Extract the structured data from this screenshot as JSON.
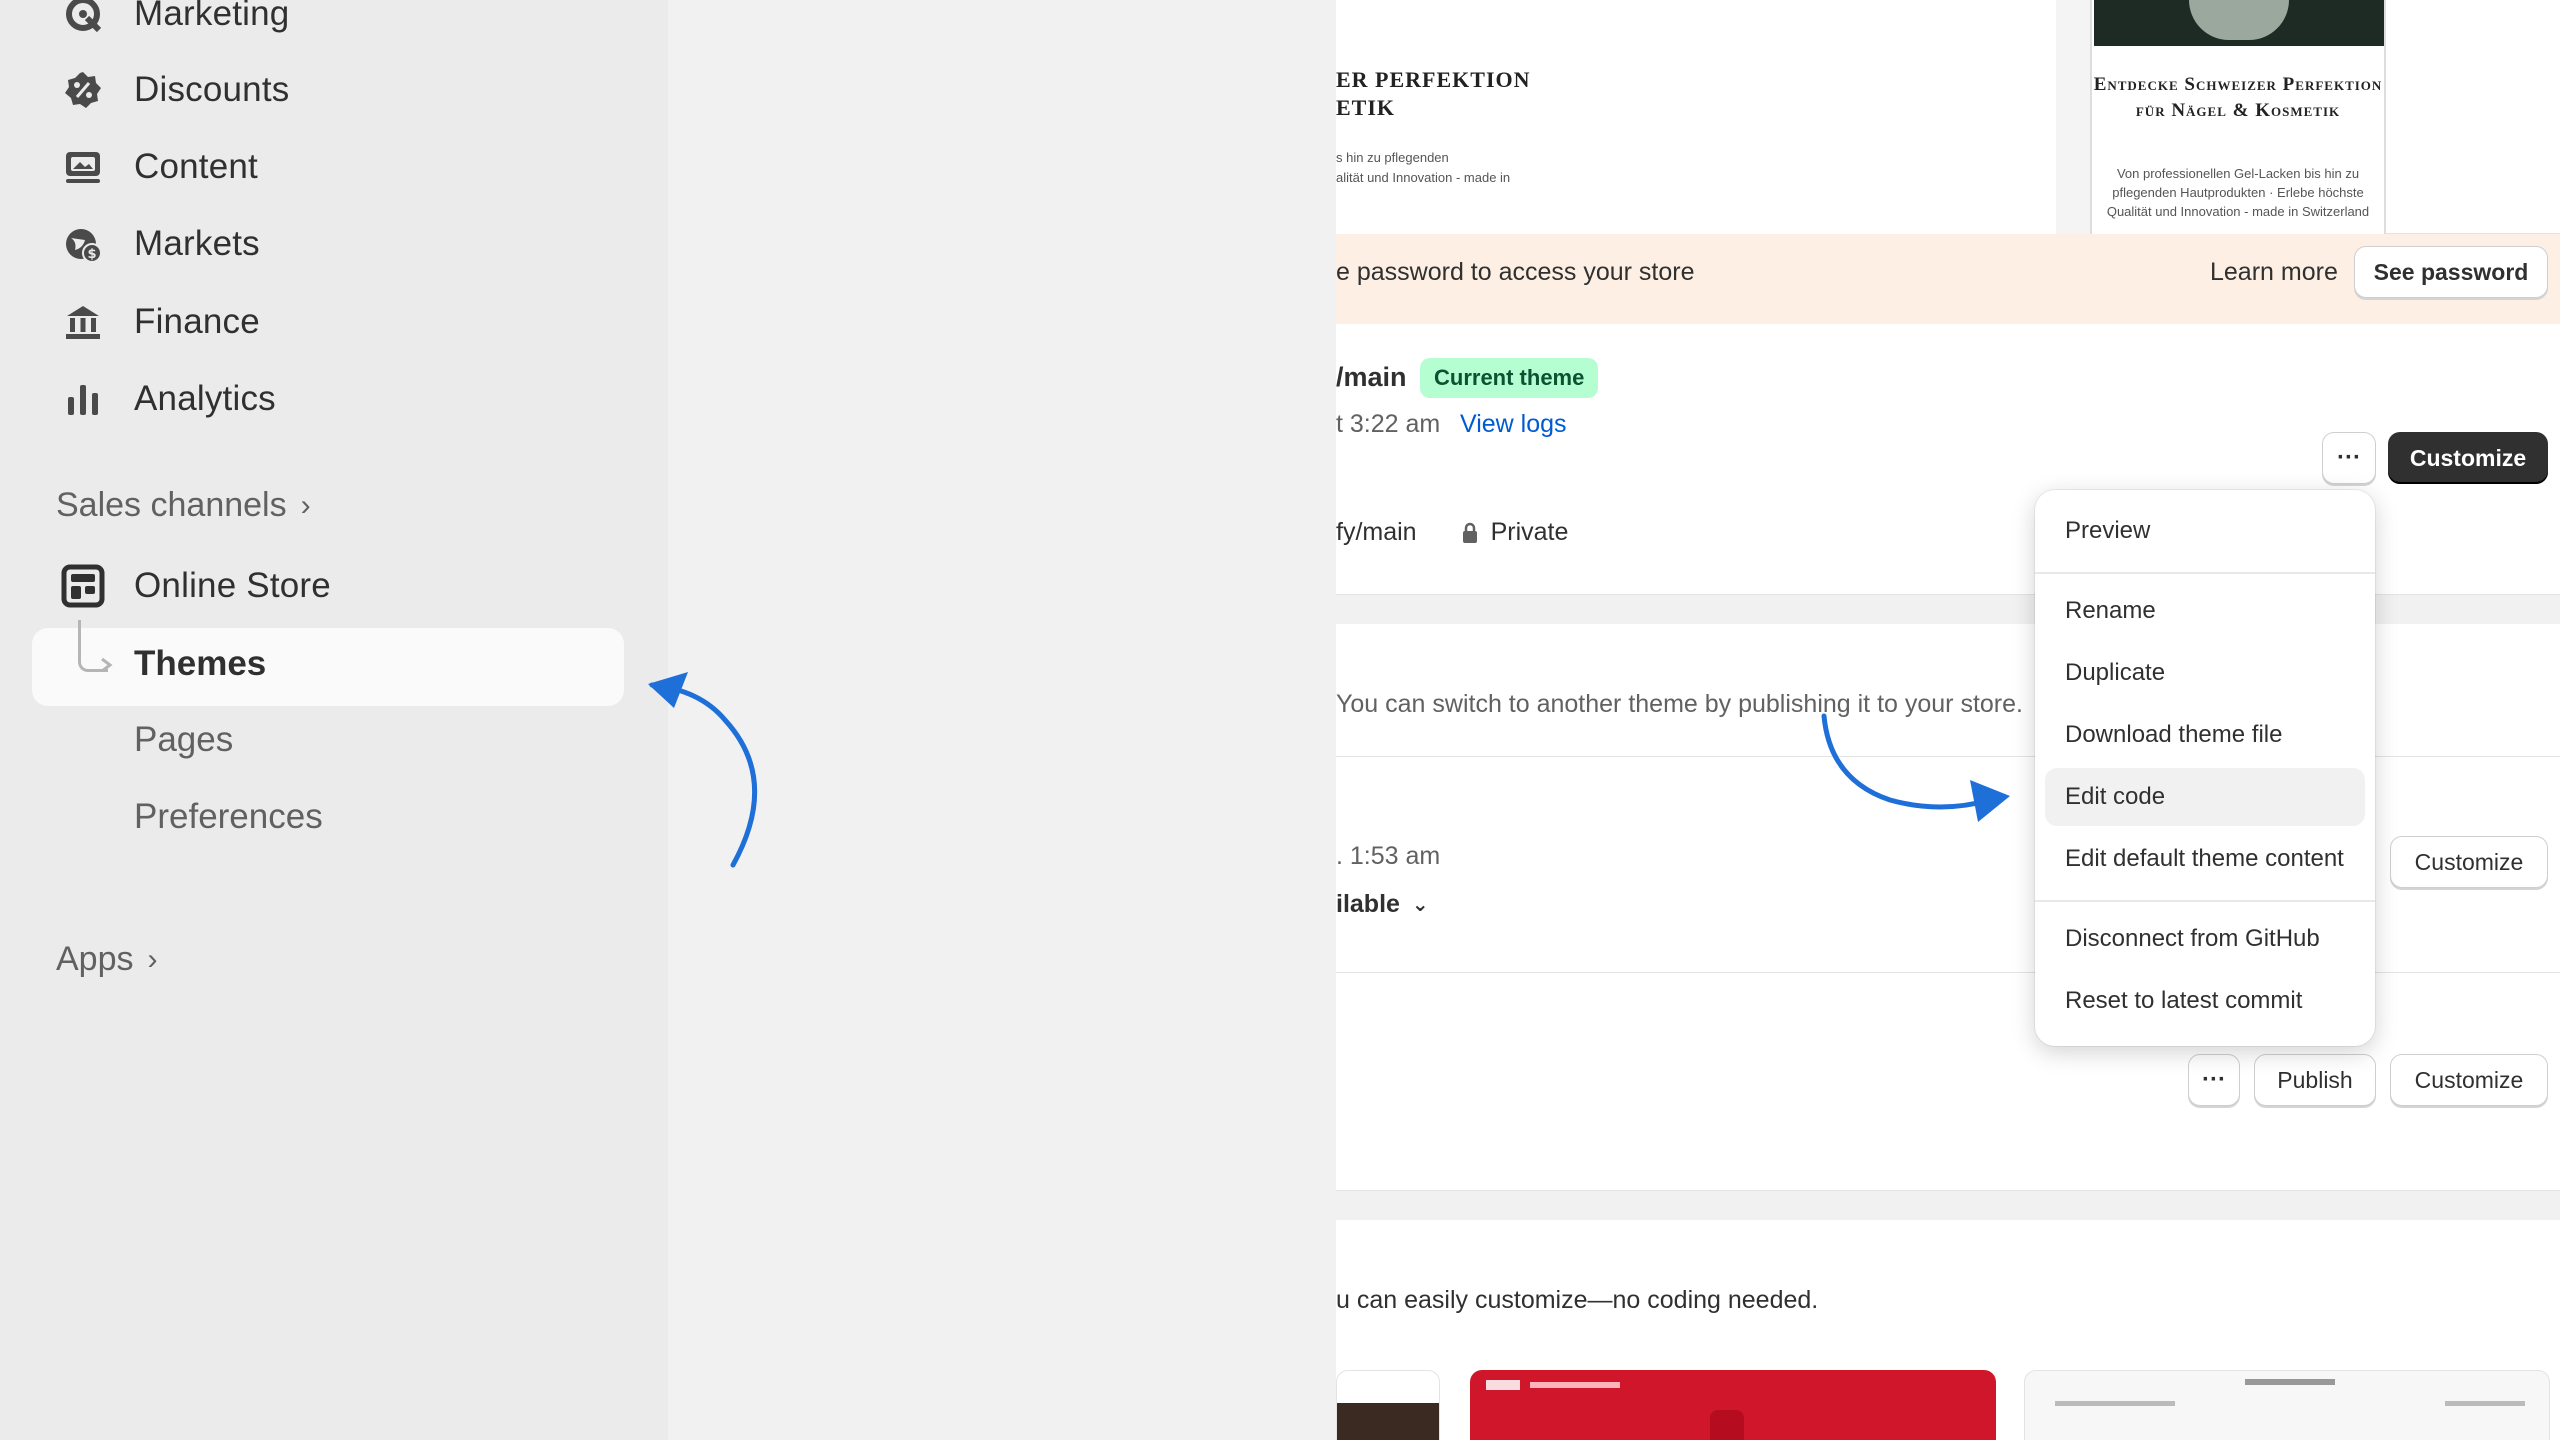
{
  "sidebar": {
    "items": [
      {
        "label": "Marketing",
        "icon": "marketing-icon"
      },
      {
        "label": "Discounts",
        "icon": "discounts-icon"
      },
      {
        "label": "Content",
        "icon": "content-icon"
      },
      {
        "label": "Markets",
        "icon": "markets-icon"
      },
      {
        "label": "Finance",
        "icon": "finance-icon"
      },
      {
        "label": "Analytics",
        "icon": "analytics-icon"
      }
    ],
    "sales_channels_label": "Sales channels",
    "online_store_label": "Online Store",
    "themes_label": "Themes",
    "pages_label": "Pages",
    "preferences_label": "Preferences",
    "apps_label": "Apps"
  },
  "preview": {
    "desktop_title_line1": "ER PERFEKTION",
    "desktop_title_line2": "ETIK",
    "desktop_text_line1": "s hin zu pflegenden",
    "desktop_text_line2": "alität und Innovation - made in",
    "mobile_title": "Entdecke Schweizer Perfektion für Nägel & Kosmetik",
    "mobile_text": "Von professionellen Gel-Lacken bis hin zu pflegenden Hautprodukten · Erlebe höchste Qualität und Innovation - made in Switzerland"
  },
  "password_banner": {
    "text": "e password to access your store",
    "learn_more": "Learn more",
    "see_password": "See password"
  },
  "current_theme": {
    "name": "/main",
    "badge": "Current theme",
    "date": "t 3:22 am",
    "view_logs": "View logs",
    "repo": "fy/main",
    "visibility": "Private",
    "more_label": "···",
    "customize": "Customize"
  },
  "library": {
    "description": "You can switch to another theme by publishing it to your store.",
    "row1": {
      "date": ". 1:53 am",
      "availability": "ilable",
      "customize": "Customize"
    },
    "row2": {
      "more_label": "···",
      "publish": "Publish",
      "customize": "Customize"
    }
  },
  "popular": {
    "description": "u can easily customize—no coding needed."
  },
  "menu": {
    "items": [
      "Preview",
      "Rename",
      "Duplicate",
      "Download theme file",
      "Edit code",
      "Edit default theme content",
      "Disconnect from GitHub",
      "Reset to latest commit"
    ],
    "hovered": "Edit code"
  },
  "colors": {
    "annotation_arrow": "#1f6fd9",
    "badge_bg": "#b4fed2",
    "banner_bg": "#fdefe3",
    "primary_button": "#303030",
    "link": "#005bd3"
  }
}
